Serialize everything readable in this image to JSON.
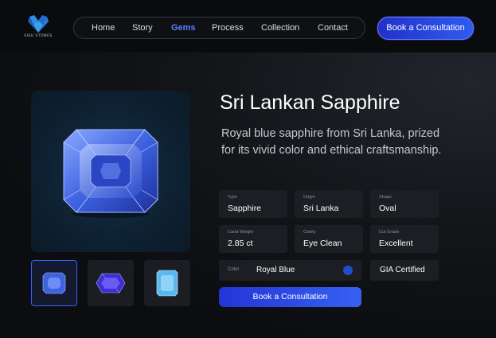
{
  "brand": {
    "logo_text": "SISU STONES"
  },
  "nav": {
    "items": [
      {
        "label": "Home",
        "active": false
      },
      {
        "label": "Story",
        "active": false
      },
      {
        "label": "Gems",
        "active": true
      },
      {
        "label": "Process",
        "active": false
      },
      {
        "label": "Collection",
        "active": false
      },
      {
        "label": "Contact",
        "active": false
      }
    ],
    "cta_label": "Book a Consultation"
  },
  "product": {
    "title": "Sri Lankan Sapphire",
    "description": "Royal blue sapphire from Sri Lanka, prized for its vivid color and ethical craftsmanship.",
    "specs": [
      {
        "label": "Type",
        "value": "Sapphire"
      },
      {
        "label": "Origin",
        "value": "Sri Lanka"
      },
      {
        "label": "Shape",
        "value": "Oval"
      },
      {
        "label": "Carat Weight",
        "value": "2.85 ct"
      },
      {
        "label": "Clarity",
        "value": "Eye Clean"
      },
      {
        "label": "Cut Grade",
        "value": "Excellent"
      }
    ],
    "color": {
      "label": "Color",
      "value": "Royal Blue",
      "swatch": "#1e4fc9"
    },
    "certification": "GIA Certified",
    "cta_label": "Book a Consultation",
    "thumbnails": [
      {
        "name": "emerald-cut-blue-sapphire",
        "active": true
      },
      {
        "name": "cushion-cut-violet-sapphire",
        "active": false
      },
      {
        "name": "emerald-cut-aqua-gem",
        "active": false
      }
    ]
  },
  "colors": {
    "accent": "#3d5cff",
    "nav_active": "#5b7bff",
    "background": "#0c0d10",
    "card": "#1c1e23"
  }
}
